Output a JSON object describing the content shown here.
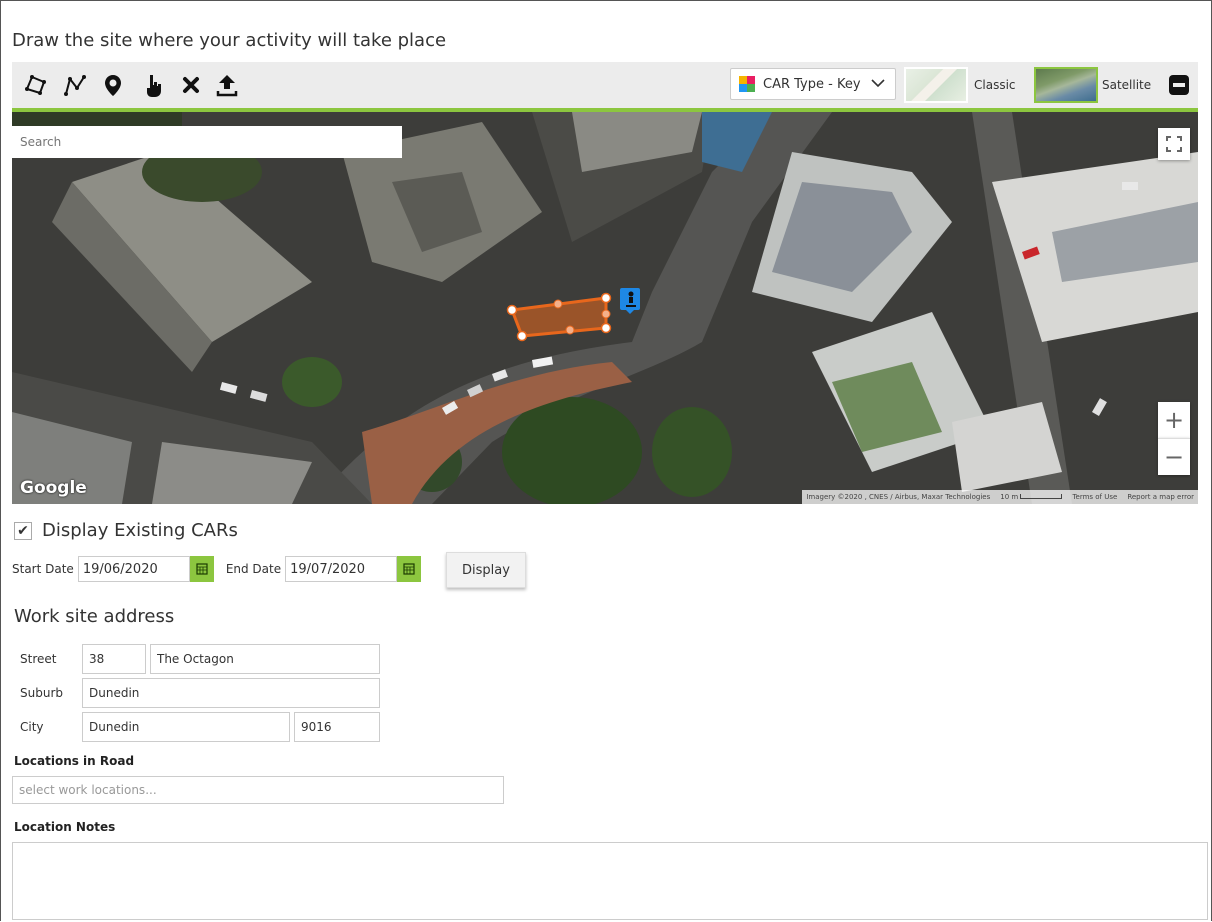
{
  "heading": "Draw the site where your activity will take place",
  "toolbar": {
    "tools": [
      "polygon-tool",
      "polyline-tool",
      "marker-tool",
      "select-tool",
      "delete-tool",
      "upload-tool"
    ],
    "car_type_label": "CAR Type - Key",
    "map_types": [
      {
        "label": "Classic",
        "selected": false
      },
      {
        "label": "Satellite",
        "selected": true
      }
    ]
  },
  "map": {
    "search_placeholder": "Search",
    "google_label": "Google",
    "attribution": "Imagery ©2020 , CNES / Airbus, Maxar Technologies",
    "scale": "10 m",
    "terms": "Terms of Use",
    "report": "Report a map error",
    "zoom_in": "+",
    "zoom_out": "−"
  },
  "display_existing": {
    "label": "Display Existing CARs",
    "checked": true,
    "start_label": "Start Date",
    "start_value": "19/06/2020",
    "end_label": "End Date",
    "end_value": "19/07/2020",
    "button": "Display"
  },
  "address": {
    "title": "Work site address",
    "street_label": "Street",
    "street_number": "38",
    "street_name": "The Octagon",
    "suburb_label": "Suburb",
    "suburb": "Dunedin",
    "city_label": "City",
    "city": "Dunedin",
    "postcode": "9016"
  },
  "locations": {
    "label": "Locations in Road",
    "placeholder": "select work locations..."
  },
  "notes": {
    "label": "Location Notes",
    "value": ""
  },
  "colors": {
    "accent": "#8cc63f",
    "drawn_shape": "#e8671c",
    "worker_icon": "#1e88e5"
  }
}
